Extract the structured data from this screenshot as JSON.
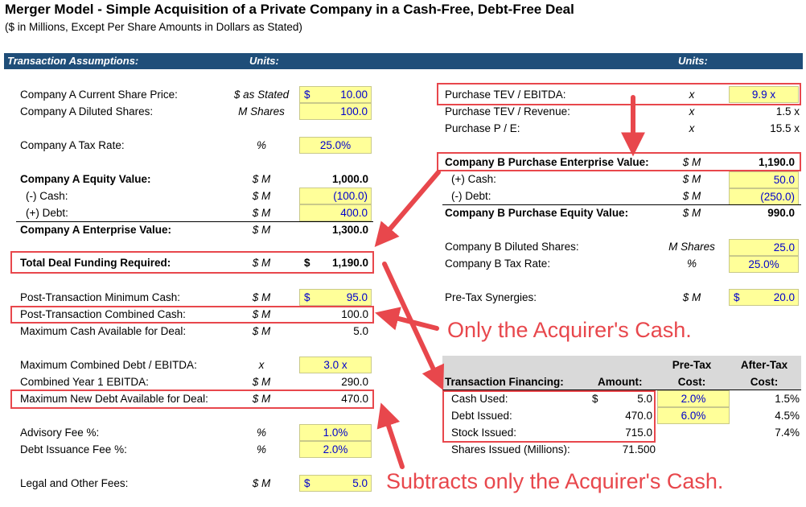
{
  "title": "Merger Model - Simple Acquisition of a Private Company in a Cash-Free, Debt-Free Deal",
  "subtitle": "($ in Millions, Except Per Share Amounts in Dollars as Stated)",
  "header": {
    "label": "Transaction Assumptions:",
    "units_left": "Units:",
    "units_right": "Units:"
  },
  "left_rows": [
    {
      "label": "Company A Current Share Price:",
      "unit": "$ as Stated",
      "dollar": "$",
      "value": "10.00"
    },
    {
      "label": "Company A Diluted Shares:",
      "unit": "M Shares",
      "value": "100.0"
    },
    {
      "label": "Company A Tax Rate:",
      "unit": "%",
      "value": "25.0%"
    },
    {
      "label": "Company A Equity Value:",
      "unit": "$ M",
      "value": "1,000.0"
    },
    {
      "label": "(-) Cash:",
      "unit": "$ M",
      "value": "(100.0)"
    },
    {
      "label": "(+) Debt:",
      "unit": "$ M",
      "value": "400.0"
    },
    {
      "label": "Company A Enterprise Value:",
      "unit": "$ M",
      "value": "1,300.0"
    },
    {
      "label": "Total Deal Funding Required:",
      "unit": "$ M",
      "dollar": "$",
      "value": "1,190.0"
    },
    {
      "label": "Post-Transaction Minimum Cash:",
      "unit": "$ M",
      "dollar": "$",
      "value": "95.0"
    },
    {
      "label": "Post-Transaction Combined Cash:",
      "unit": "$ M",
      "value": "100.0"
    },
    {
      "label": "Maximum Cash Available for Deal:",
      "unit": "$ M",
      "value": "5.0"
    },
    {
      "label": "Maximum Combined Debt / EBITDA:",
      "unit": "x",
      "value": "3.0 x"
    },
    {
      "label": "Combined Year 1 EBITDA:",
      "unit": "$ M",
      "value": "290.0"
    },
    {
      "label": "Maximum New Debt Available for Deal:",
      "unit": "$ M",
      "value": "470.0"
    },
    {
      "label": "Advisory Fee %:",
      "unit": "%",
      "value": "1.0%"
    },
    {
      "label": "Debt Issuance Fee %:",
      "unit": "%",
      "value": "2.0%"
    },
    {
      "label": "Legal and Other Fees:",
      "unit": "$ M",
      "dollar": "$",
      "value": "5.0"
    }
  ],
  "right_rows": [
    {
      "label": "Purchase TEV / EBITDA:",
      "unit": "x",
      "value": "9.9 x"
    },
    {
      "label": "Purchase TEV / Revenue:",
      "unit": "x",
      "value": "1.5 x"
    },
    {
      "label": "Purchase P / E:",
      "unit": "x",
      "value": "15.5 x"
    },
    {
      "label": "Company B Purchase Enterprise Value:",
      "unit": "$ M",
      "value": "1,190.0"
    },
    {
      "label": "(+) Cash:",
      "unit": "$ M",
      "value": "50.0"
    },
    {
      "label": "(-) Debt:",
      "unit": "$ M",
      "value": "(250.0)"
    },
    {
      "label": "Company B Purchase Equity Value:",
      "unit": "$ M",
      "value": "990.0"
    },
    {
      "label": "Company B Diluted Shares:",
      "unit": "M Shares",
      "value": "25.0"
    },
    {
      "label": "Company B Tax Rate:",
      "unit": "%",
      "value": "25.0%"
    },
    {
      "label": "Pre-Tax Synergies:",
      "unit": "$ M",
      "dollar": "$",
      "value": "20.0"
    }
  ],
  "financing": {
    "header_label": "Transaction Financing:",
    "header_amount": "Amount:",
    "header_pretax_1": "Pre-Tax",
    "header_pretax_2": "Cost:",
    "header_aftertax_1": "After-Tax",
    "header_aftertax_2": "Cost:",
    "rows": [
      {
        "label": "Cash Used:",
        "dollar": "$",
        "amount": "5.0",
        "pretax": "2.0%",
        "aftertax": "1.5%"
      },
      {
        "label": "Debt Issued:",
        "amount": "470.0",
        "pretax": "6.0%",
        "aftertax": "4.5%"
      },
      {
        "label": "Stock Issued:",
        "amount": "715.0",
        "pretax": "",
        "aftertax": "7.4%"
      }
    ],
    "shares_label": "Shares Issued (Millions):",
    "shares_value": "71.500"
  },
  "callouts": {
    "acquirer_cash": "Only the Acquirer's Cash.",
    "subtracts_cash": "Subtracts only the Acquirer's Cash."
  },
  "colors": {
    "header": "#1F4E79",
    "input_fill": "#FFFF99",
    "input_text": "#0000CC",
    "annotation": "#E8474C"
  }
}
